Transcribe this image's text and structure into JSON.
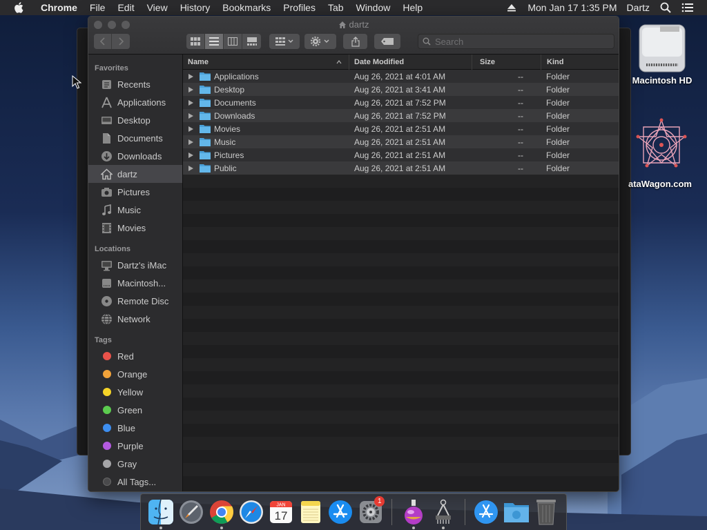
{
  "menubar": {
    "app_name": "Chrome",
    "menus": [
      "File",
      "Edit",
      "View",
      "History",
      "Bookmarks",
      "Profiles",
      "Tab",
      "Window",
      "Help"
    ],
    "clock": "Mon Jan 17  1:35 PM",
    "user": "Dartz"
  },
  "desktop": {
    "icons": [
      {
        "label": "Macintosh HD"
      },
      {
        "label": "ataWagon.com"
      }
    ]
  },
  "finder": {
    "title": "dartz",
    "search_placeholder": "Search",
    "sidebar": {
      "favorites_header": "Favorites",
      "favorites": [
        {
          "label": "Recents",
          "icon": "clock-icon"
        },
        {
          "label": "Applications",
          "icon": "applications-icon"
        },
        {
          "label": "Desktop",
          "icon": "desktop-icon"
        },
        {
          "label": "Documents",
          "icon": "document-icon"
        },
        {
          "label": "Downloads",
          "icon": "download-icon"
        },
        {
          "label": "dartz",
          "icon": "home-icon",
          "selected": true
        },
        {
          "label": "Pictures",
          "icon": "camera-icon"
        },
        {
          "label": "Music",
          "icon": "music-note-icon"
        },
        {
          "label": "Movies",
          "icon": "film-icon"
        }
      ],
      "locations_header": "Locations",
      "locations": [
        {
          "label": "Dartz's iMac",
          "icon": "imac-icon"
        },
        {
          "label": "Macintosh...",
          "icon": "hard-drive-icon"
        },
        {
          "label": "Remote Disc",
          "icon": "disc-icon"
        },
        {
          "label": "Network",
          "icon": "network-globe-icon"
        }
      ],
      "tags_header": "Tags",
      "tags": [
        {
          "label": "Red",
          "color": "#e9524a"
        },
        {
          "label": "Orange",
          "color": "#f2a33a"
        },
        {
          "label": "Yellow",
          "color": "#f5d428"
        },
        {
          "label": "Green",
          "color": "#5ccc4f"
        },
        {
          "label": "Blue",
          "color": "#3d8ef0"
        },
        {
          "label": "Purple",
          "color": "#b45ae0"
        },
        {
          "label": "Gray",
          "color": "#a5a5a8"
        },
        {
          "label": "All Tags...",
          "color": "#4a4a4c"
        }
      ]
    },
    "columns": {
      "name": "Name",
      "date": "Date Modified",
      "size": "Size",
      "kind": "Kind"
    },
    "files": [
      {
        "name": "Applications",
        "date": "Aug 26, 2021 at 4:01 AM",
        "size": "--",
        "kind": "Folder"
      },
      {
        "name": "Desktop",
        "date": "Aug 26, 2021 at 3:41 AM",
        "size": "--",
        "kind": "Folder"
      },
      {
        "name": "Documents",
        "date": "Aug 26, 2021 at 7:52 PM",
        "size": "--",
        "kind": "Folder"
      },
      {
        "name": "Downloads",
        "date": "Aug 26, 2021 at 7:52 PM",
        "size": "--",
        "kind": "Folder"
      },
      {
        "name": "Movies",
        "date": "Aug 26, 2021 at 2:51 AM",
        "size": "--",
        "kind": "Folder"
      },
      {
        "name": "Music",
        "date": "Aug 26, 2021 at 2:51 AM",
        "size": "--",
        "kind": "Folder"
      },
      {
        "name": "Pictures",
        "date": "Aug 26, 2021 at 2:51 AM",
        "size": "--",
        "kind": "Folder"
      },
      {
        "name": "Public",
        "date": "Aug 26, 2021 at 2:51 AM",
        "size": "--",
        "kind": "Folder"
      }
    ]
  },
  "dock": {
    "apps": [
      {
        "icon": "finder-icon",
        "running": true
      },
      {
        "icon": "launchpad-icon",
        "running": false
      },
      {
        "icon": "chrome-icon",
        "running": true
      },
      {
        "icon": "safari-icon",
        "running": false
      },
      {
        "icon": "calendar-icon",
        "running": false,
        "month": "JAN",
        "day": "17"
      },
      {
        "icon": "notes-icon",
        "running": false
      },
      {
        "icon": "app-store-icon",
        "running": false
      },
      {
        "icon": "system-preferences-icon",
        "running": false,
        "badge": "1"
      },
      {
        "icon": "installer-potion-icon",
        "running": true
      },
      {
        "icon": "screenshot-tool-icon",
        "running": true
      },
      {
        "icon": "app-store-download-icon",
        "running": false
      },
      {
        "icon": "downloads-folder-icon",
        "running": false
      },
      {
        "icon": "trash-icon",
        "running": false
      }
    ]
  }
}
